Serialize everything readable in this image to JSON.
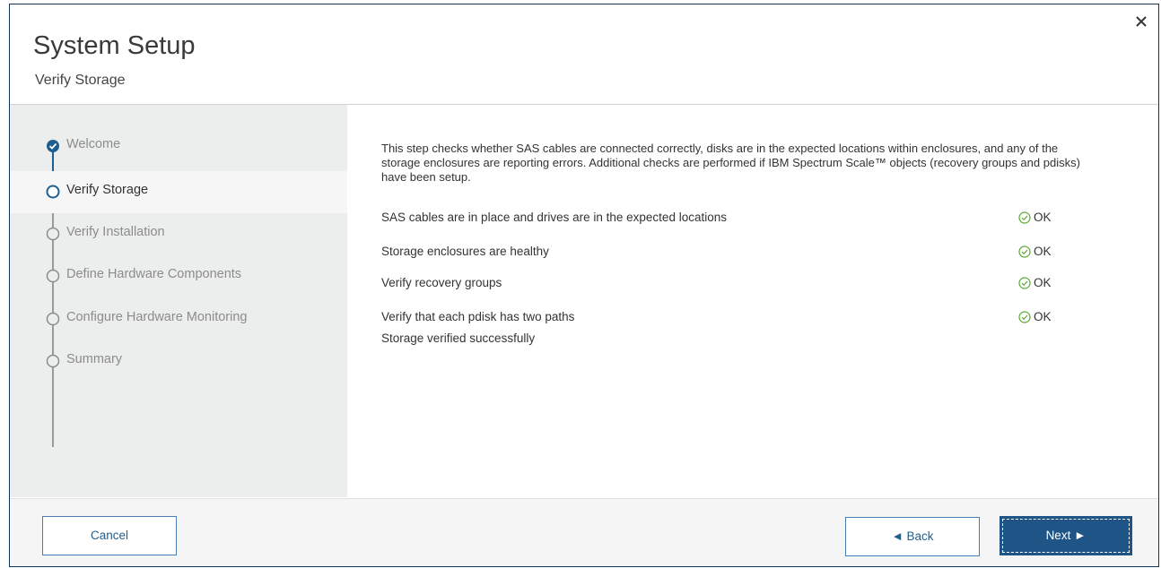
{
  "dialog": {
    "title": "System Setup",
    "subtitle": "Verify Storage",
    "close_icon": "close-icon"
  },
  "steps": [
    {
      "label": "Welcome",
      "state": "completed"
    },
    {
      "label": "Verify Storage",
      "state": "current"
    },
    {
      "label": "Verify Installation",
      "state": "pending"
    },
    {
      "label": "Define Hardware Components",
      "state": "pending"
    },
    {
      "label": "Configure Hardware Monitoring",
      "state": "pending"
    },
    {
      "label": "Summary",
      "state": "pending"
    }
  ],
  "content": {
    "description": "This step checks whether SAS cables are connected correctly, disks are in the expected locations within enclosures, and any of the storage enclosures are reporting errors. Additional checks are performed if IBM Spectrum Scale™ objects (recovery groups and pdisks) have been setup.",
    "checks": [
      {
        "label": "SAS cables are in place and drives are in the expected locations",
        "status": "OK"
      },
      {
        "label": "Storage enclosures are healthy",
        "status": "OK"
      },
      {
        "label": "Verify recovery groups",
        "status": "OK"
      },
      {
        "label": "Verify that each pdisk has two paths",
        "status": "OK"
      }
    ],
    "result": "Storage verified successfully"
  },
  "footer": {
    "cancel_label": "Cancel",
    "back_label": "◄ Back",
    "next_label": "Next ►"
  },
  "colors": {
    "accent": "#1f5586",
    "ok": "#5aa832",
    "sidebar_bg": "#eceded"
  }
}
